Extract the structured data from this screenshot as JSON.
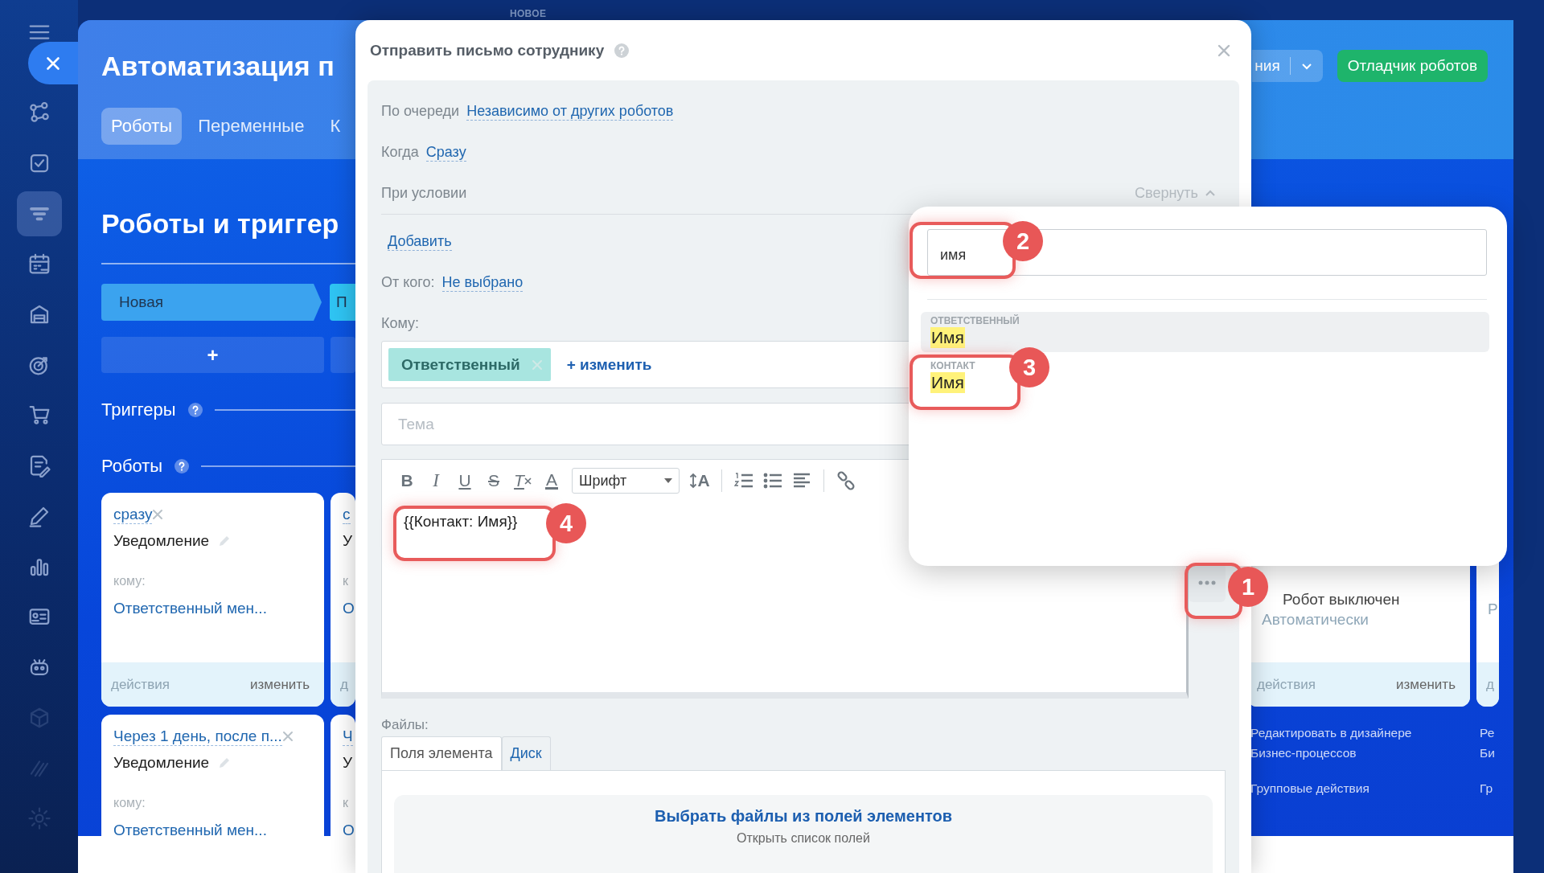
{
  "top_bar": {
    "badge": "НОВОЕ"
  },
  "sidebar": {
    "items": [
      {
        "kind": "menu",
        "selected": false,
        "dimmed": false
      },
      {
        "kind": "close",
        "selected": false,
        "dimmed": false
      },
      {
        "kind": "flow",
        "selected": false,
        "dimmed": false
      },
      {
        "kind": "task",
        "selected": false,
        "dimmed": false
      },
      {
        "kind": "funnel",
        "selected": true,
        "dimmed": false
      },
      {
        "kind": "calendar",
        "selected": false,
        "dimmed": false
      },
      {
        "kind": "store",
        "selected": false,
        "dimmed": false
      },
      {
        "kind": "target",
        "selected": false,
        "dimmed": false
      },
      {
        "kind": "cart",
        "selected": false,
        "dimmed": false
      },
      {
        "kind": "doc",
        "selected": false,
        "dimmed": false
      },
      {
        "kind": "pencil",
        "selected": false,
        "dimmed": false
      },
      {
        "kind": "chart",
        "selected": false,
        "dimmed": false
      },
      {
        "kind": "card",
        "selected": false,
        "dimmed": false
      },
      {
        "kind": "robot",
        "selected": false,
        "dimmed": false
      },
      {
        "kind": "cube",
        "selected": false,
        "dimmed": true
      },
      {
        "kind": "stripes",
        "selected": false,
        "dimmed": true
      },
      {
        "kind": "gear",
        "selected": false,
        "dimmed": true
      }
    ]
  },
  "page": {
    "title": "Автоматизация п",
    "tabs": [
      {
        "label": "Роботы",
        "selected": true
      },
      {
        "label": "Переменные",
        "selected": false
      },
      {
        "label": "К",
        "selected": false
      }
    ],
    "actions": [
      {
        "kind": "split",
        "label": "ния"
      },
      {
        "kind": "primary",
        "label": "Отладчик роботов"
      }
    ],
    "heading": "Роботы и триггер",
    "stages": [
      {
        "label": "Новая",
        "color": "#3ba3ef",
        "add": "+"
      },
      {
        "label": "П",
        "color": "#2fc4f3"
      }
    ],
    "triggers_title": "Триггеры",
    "robots_title": "Роботы",
    "columns": [
      {
        "cards": [
          {
            "kind": "robot",
            "when": "сразу",
            "title": "Уведомление",
            "to_label": "кому:",
            "to": "Ответственный мен...",
            "footer_left": "действия",
            "footer_right": "изменить"
          },
          {
            "kind": "robot",
            "when": "Через 1 день, после п...",
            "title": "Уведомление",
            "to_label": "кому:",
            "to": "Ответственный мен..."
          }
        ]
      },
      {
        "cards": [
          {
            "kind": "partial",
            "when": "с",
            "title": "У",
            "to_label": "к",
            "to": "О",
            "footer_left": "д"
          },
          {
            "kind": "partial",
            "when": "Ч",
            "title": "У",
            "to_label": "к",
            "to": "О"
          }
        ]
      },
      {
        "cards": [
          {
            "kind": "status",
            "status": "Робот выключен",
            "note": "Автоматически",
            "footer_left": "действия",
            "footer_right": "изменить"
          }
        ],
        "links": [
          "Редактировать в дизайнере Бизнес-процессов",
          "Групповые действия"
        ]
      },
      {
        "cards": [
          {
            "kind": "partial",
            "note": "Р",
            "footer_left": "д"
          }
        ],
        "links": [
          "Ре Би",
          "Гр"
        ]
      }
    ]
  },
  "dialog": {
    "title": "Отправить письмо сотруднику",
    "fields": [
      {
        "label": "По очереди",
        "value": "Независимо от других роботов"
      },
      {
        "label": "Когда",
        "value": "Сразу"
      }
    ],
    "condition": {
      "label": "При условии",
      "collapse": "Свернуть",
      "add": "Добавить"
    },
    "from": {
      "label": "От кого:",
      "value": "Не выбрано"
    },
    "to": {
      "label": "Кому:",
      "chips": [
        "Ответственный"
      ],
      "change": "+ изменить"
    },
    "subject": {
      "placeholder": "Тема"
    },
    "editor": {
      "toolbar": [
        {
          "kind": "bold",
          "label": "B"
        },
        {
          "kind": "italic",
          "label": "I"
        },
        {
          "kind": "underline",
          "label": "U"
        },
        {
          "kind": "strike",
          "label": "S"
        },
        {
          "kind": "clear",
          "label": "T"
        },
        {
          "kind": "color",
          "label": "A"
        },
        {
          "kind": "font",
          "label": "Шрифт"
        },
        {
          "kind": "size",
          "label": "A"
        },
        {
          "kind": "separator"
        },
        {
          "kind": "numbered"
        },
        {
          "kind": "bulleted"
        },
        {
          "kind": "align"
        },
        {
          "kind": "separator"
        },
        {
          "kind": "link"
        }
      ],
      "content": "{{Контакт: Имя}}"
    },
    "files": {
      "label": "Файлы:",
      "tabs": [
        {
          "label": "Поля элемента",
          "selected": true
        },
        {
          "label": "Диск",
          "selected": false
        }
      ],
      "action": "Выбрать файлы из полей элементов",
      "hint": "Открыть список полей"
    }
  },
  "field_picker": {
    "search": {
      "value": "имя"
    },
    "groups": [
      {
        "title": "ОТВЕТСТВЕННЫЙ",
        "items": [
          {
            "label": "Имя",
            "selected": true,
            "matched": true
          }
        ]
      },
      {
        "title": "КОНТАКТ",
        "items": [
          {
            "label": "Имя",
            "selected": false,
            "matched": true
          }
        ]
      }
    ]
  },
  "annotations": [
    {
      "number": "1"
    },
    {
      "number": "2"
    },
    {
      "number": "3"
    },
    {
      "number": "4"
    }
  ]
}
